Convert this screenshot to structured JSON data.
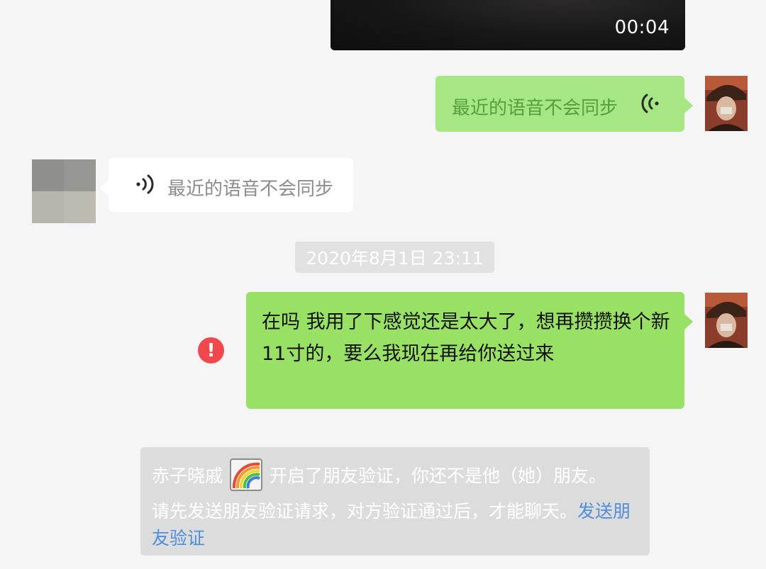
{
  "video": {
    "duration": "00:04"
  },
  "voice_out": {
    "text": "最近的语音不会同步",
    "icon": "voice-wave-icon"
  },
  "voice_in": {
    "text": "最近的语音不会同步",
    "icon": "voice-wave-icon"
  },
  "timestamp": "2020年8月1日 23:11",
  "message": {
    "text": "在吗 我用了下感觉还是太大了，想再攒攒换个新11寸的，要么我现在再给你送过来",
    "status": "send-failed",
    "error_glyph": "!"
  },
  "notice": {
    "name": "赤子晓戚",
    "line1_rest": "开启了朋友验证，你还不是他（她）朋友。",
    "line2": "请先发送朋友验证请求，对方验证通过后，才能聊天。",
    "link": "发送朋友验证"
  },
  "colors": {
    "bubble_self": "#98e165",
    "bubble_self_muted": "#a6e783",
    "bubble_other": "#ffffff",
    "error": "#f0484c",
    "link": "#4f8ddb",
    "background": "#f5f5f5"
  }
}
